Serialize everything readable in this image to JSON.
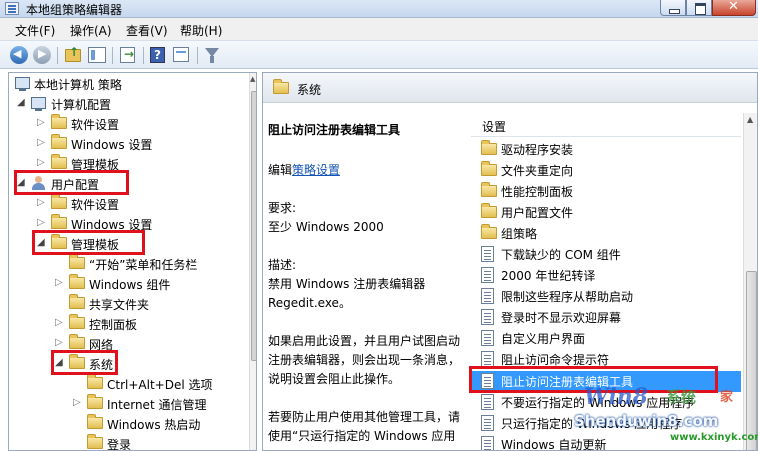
{
  "window": {
    "title": "本地组策略编辑器"
  },
  "menu": [
    "文件(F)",
    "操作(A)",
    "查看(V)",
    "帮助(H)"
  ],
  "toolbar_icons": [
    "back-arrow-icon",
    "forward-arrow-icon",
    "up-folder-icon",
    "show-tree-icon",
    "export-list-icon",
    "help-icon",
    "extended-view-icon",
    "filter-icon"
  ],
  "tree": {
    "root": "本地计算机 策略",
    "computer_config": "计算机配置",
    "cc_software": "软件设置",
    "cc_windows": "Windows 设置",
    "cc_admin": "管理模板",
    "user_config": "用户配置",
    "uc_software": "软件设置",
    "uc_windows": "Windows 设置",
    "uc_admin": "管理模板",
    "start_menu": "“开始”菜单和任务栏",
    "windows_components": "Windows 组件",
    "shared_folders": "共享文件夹",
    "control_panel": "控制面板",
    "network": "网络",
    "system": "系统",
    "ctrl_alt_del": "Ctrl+Alt+Del 选项",
    "internet_comm": "Internet 通信管理",
    "windows_hotstart": "Windows 热启动",
    "logon": "登录"
  },
  "right": {
    "header": "系统",
    "desc": {
      "title": "阻止访问注册表编辑工具",
      "edit_prefix": "编辑",
      "edit_link": "策略设置",
      "req_label": "要求:",
      "req_value": "至少 Windows 2000",
      "desc_label": "描述:",
      "desc_line1": "禁用 Windows 注册表编辑器",
      "desc_line2": "Regedit.exe。",
      "para_line1": "如果启用此设置，并且用户试图启动",
      "para_line2": "注册表编辑器，则会出现一条消息，",
      "para_line3": "说明设置会阻止此操作。",
      "para2_line1": "若要防止用户使用其他管理工具，请",
      "para2_line2": "使用“只运行指定的 Windows 应用"
    },
    "list_header": "设置",
    "list_items": [
      {
        "label": "驱动程序安装",
        "icon": "folder-icon"
      },
      {
        "label": "文件夹重定向",
        "icon": "folder-icon"
      },
      {
        "label": "性能控制面板",
        "icon": "folder-icon"
      },
      {
        "label": "用户配置文件",
        "icon": "folder-icon"
      },
      {
        "label": "组策略",
        "icon": "folder-icon"
      },
      {
        "label": "下载缺少的 COM 组件",
        "icon": "policy-icon"
      },
      {
        "label": "2000 年世纪转译",
        "icon": "policy-icon"
      },
      {
        "label": "限制这些程序从帮助启动",
        "icon": "policy-icon"
      },
      {
        "label": "登录时不显示欢迎屏幕",
        "icon": "policy-icon"
      },
      {
        "label": "自定义用户界面",
        "icon": "policy-icon"
      },
      {
        "label": "阻止访问命令提示符",
        "icon": "policy-icon"
      },
      {
        "label": "阻止访问注册表编辑工具",
        "icon": "policy-icon"
      },
      {
        "label": "不要运行指定的 Windows 应用程序",
        "icon": "policy-icon"
      },
      {
        "label": "只运行指定的 Windows 应用程序",
        "icon": "policy-icon"
      },
      {
        "label": "Windows 自动更新",
        "icon": "policy-icon"
      }
    ]
  },
  "watermark": {
    "logo": "Win8",
    "side_green": "系统",
    "side_red": "家",
    "url1": "Shenduwin8.com",
    "url2": "www.kxinyk.com"
  },
  "colors": {
    "highlight_box": "#e0101c",
    "selection": "#3399ff",
    "link": "#1355b5"
  }
}
